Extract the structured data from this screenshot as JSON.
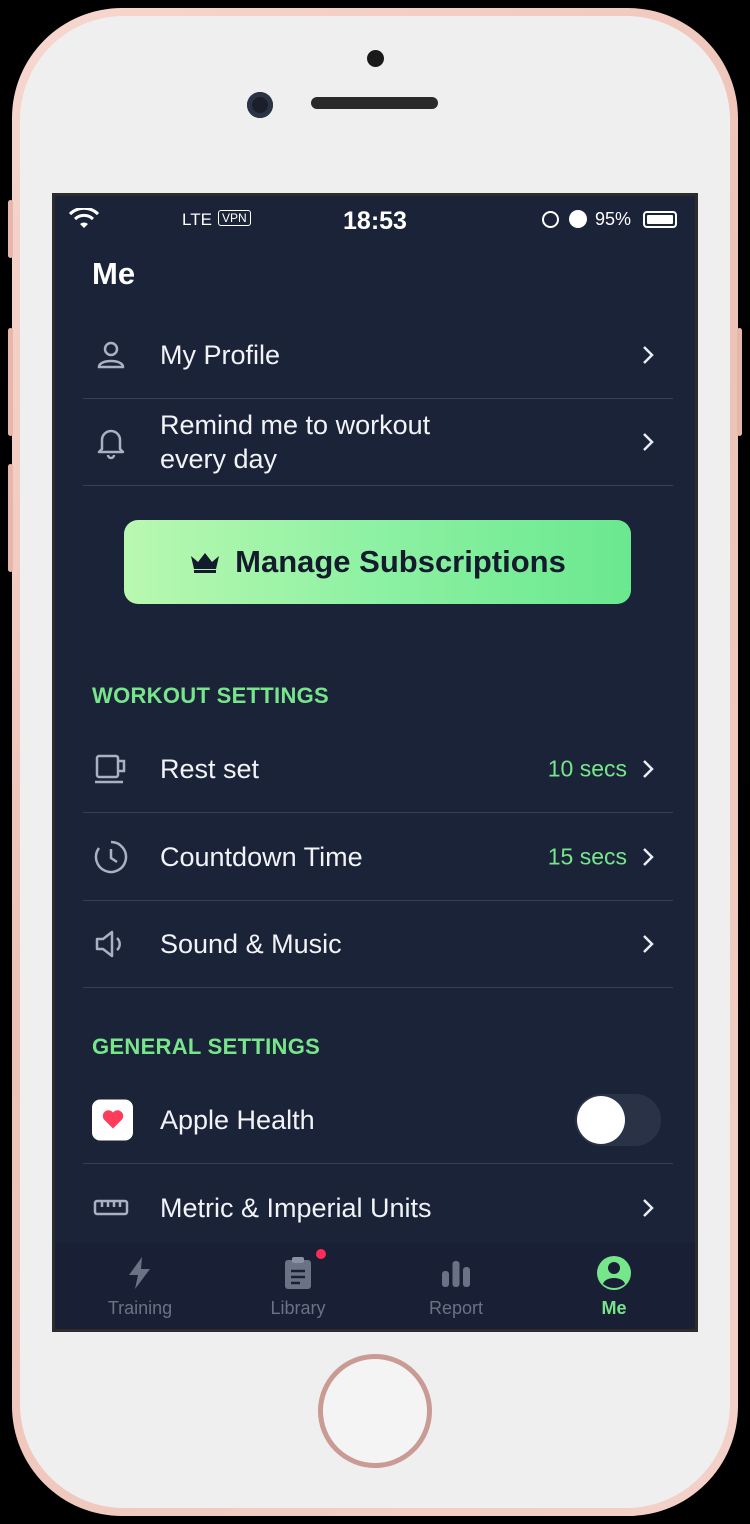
{
  "status_bar": {
    "carrier": "LTE",
    "vpn": "VPN",
    "time": "18:53",
    "battery": "95%"
  },
  "page": {
    "title": "Me"
  },
  "account_items": [
    {
      "label": "My Profile",
      "icon": "person-icon"
    },
    {
      "label": "Remind me to workout every day",
      "icon": "bell-icon"
    }
  ],
  "subscription_button": {
    "label": "Manage Subscriptions",
    "icon": "crown-icon"
  },
  "workout_settings": {
    "heading": "WORKOUT SETTINGS",
    "items": [
      {
        "label": "Rest set",
        "value": "10 secs",
        "icon": "cup-icon"
      },
      {
        "label": "Countdown Time",
        "value": "15 secs",
        "icon": "timer-icon"
      },
      {
        "label": "Sound & Music",
        "value": "",
        "icon": "speaker-icon"
      }
    ]
  },
  "general_settings": {
    "heading": "GENERAL SETTINGS",
    "items": [
      {
        "label": "Apple Health",
        "icon": "health-heart-icon",
        "toggle": false
      },
      {
        "label": "Metric & Imperial Units",
        "icon": "ruler-icon"
      }
    ]
  },
  "tabs": [
    {
      "label": "Training",
      "icon": "bolt-icon",
      "active": false
    },
    {
      "label": "Library",
      "icon": "clipboard-icon",
      "active": false,
      "badge": true
    },
    {
      "label": "Report",
      "icon": "bar-chart-icon",
      "active": false
    },
    {
      "label": "Me",
      "icon": "user-circle-icon",
      "active": true
    }
  ],
  "colors": {
    "background": "#1b2338",
    "accent": "#77e68b",
    "text": "#f1f3f7"
  }
}
